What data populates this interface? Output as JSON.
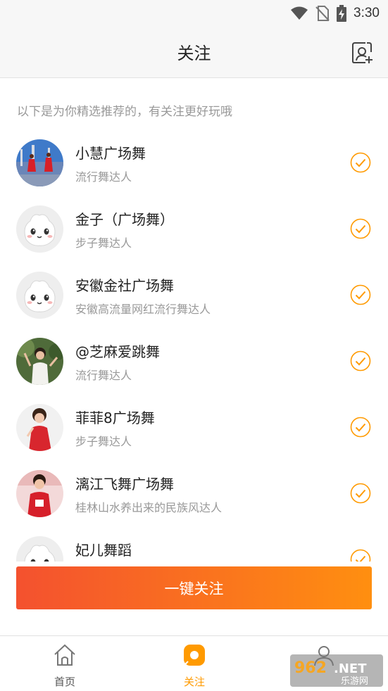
{
  "status_bar": {
    "time": "3:30"
  },
  "header": {
    "title": "关注"
  },
  "hint": "以下是为你精选推荐的，有关注更好玩哦",
  "recommendations": [
    {
      "name": "小慧广场舞",
      "desc": "流行舞达人",
      "avatar": "dance-photo",
      "selected": true
    },
    {
      "name": "金子（广场舞）",
      "desc": "步子舞达人",
      "avatar": "default-mascot",
      "selected": true
    },
    {
      "name": "安徽金社广场舞",
      "desc": "安徽高流量网红流行舞达人",
      "avatar": "default-mascot",
      "selected": true
    },
    {
      "name": "@芝麻爱跳舞",
      "desc": "流行舞达人",
      "avatar": "person-photo",
      "selected": true
    },
    {
      "name": "菲菲8广场舞",
      "desc": "步子舞达人",
      "avatar": "person-photo",
      "selected": true
    },
    {
      "name": "漓江飞舞广场舞",
      "desc": "桂林山水养出来的民族风达人",
      "avatar": "person-photo",
      "selected": true
    },
    {
      "name": "妃儿舞蹈",
      "desc": "",
      "avatar": "default-mascot",
      "selected": true
    }
  ],
  "follow_all_label": "一键关注",
  "tabs": [
    {
      "label": "首页",
      "icon": "home-icon",
      "active": false
    },
    {
      "label": "关注",
      "icon": "follow-icon",
      "active": true
    },
    {
      "label": "",
      "icon": "profile-icon",
      "active": false
    }
  ],
  "colors": {
    "accent": "#ff9a00",
    "button_start": "#f4512f",
    "button_end": "#ff8f10",
    "tab_inactive": "#555555"
  },
  "watermark": {
    "number": "962",
    "suffix": ".NET",
    "caption": "乐游网"
  }
}
